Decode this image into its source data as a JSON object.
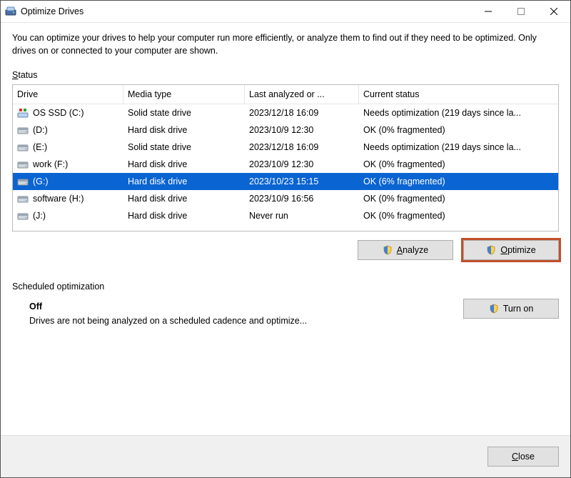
{
  "window": {
    "title": "Optimize Drives"
  },
  "intro": "You can optimize your drives to help your computer run more efficiently, or analyze them to find out if they need to be optimized. Only drives on or connected to your computer are shown.",
  "status_label_pre": "S",
  "status_label_post": "tatus",
  "columns": {
    "drive": "Drive",
    "media": "Media type",
    "last": "Last analyzed or ...",
    "status": "Current status"
  },
  "drives": [
    {
      "icon": "ssd-os",
      "name": "OS SSD (C:)",
      "media": "Solid state drive",
      "last": "2023/12/18 16:09",
      "status": "Needs optimization (219 days since la...",
      "selected": false
    },
    {
      "icon": "hdd",
      "name": "(D:)",
      "media": "Hard disk drive",
      "last": "2023/10/9 12:30",
      "status": "OK (0% fragmented)",
      "selected": false
    },
    {
      "icon": "hdd",
      "name": "(E:)",
      "media": "Solid state drive",
      "last": "2023/12/18 16:09",
      "status": "Needs optimization (219 days since la...",
      "selected": false
    },
    {
      "icon": "hdd",
      "name": "work (F:)",
      "media": "Hard disk drive",
      "last": "2023/10/9 12:30",
      "status": "OK (0% fragmented)",
      "selected": false
    },
    {
      "icon": "hdd",
      "name": "(G:)",
      "media": "Hard disk drive",
      "last": "2023/10/23 15:15",
      "status": "OK (6% fragmented)",
      "selected": true
    },
    {
      "icon": "hdd",
      "name": "software (H:)",
      "media": "Hard disk drive",
      "last": "2023/10/9 16:56",
      "status": "OK (0% fragmented)",
      "selected": false
    },
    {
      "icon": "hdd",
      "name": "(J:)",
      "media": "Hard disk drive",
      "last": "Never run",
      "status": "OK (0% fragmented)",
      "selected": false
    }
  ],
  "buttons": {
    "analyze_pre": "A",
    "analyze_post": "nalyze",
    "optimize_pre": "O",
    "optimize_post": "ptimize"
  },
  "scheduled": {
    "label": "Scheduled optimization",
    "state": "Off",
    "description": "Drives are not being analyzed on a scheduled cadence and optimize...",
    "turn_on_pre": "T",
    "turn_on_post": "urn on"
  },
  "footer": {
    "close_pre": "C",
    "close_post": "lose"
  }
}
